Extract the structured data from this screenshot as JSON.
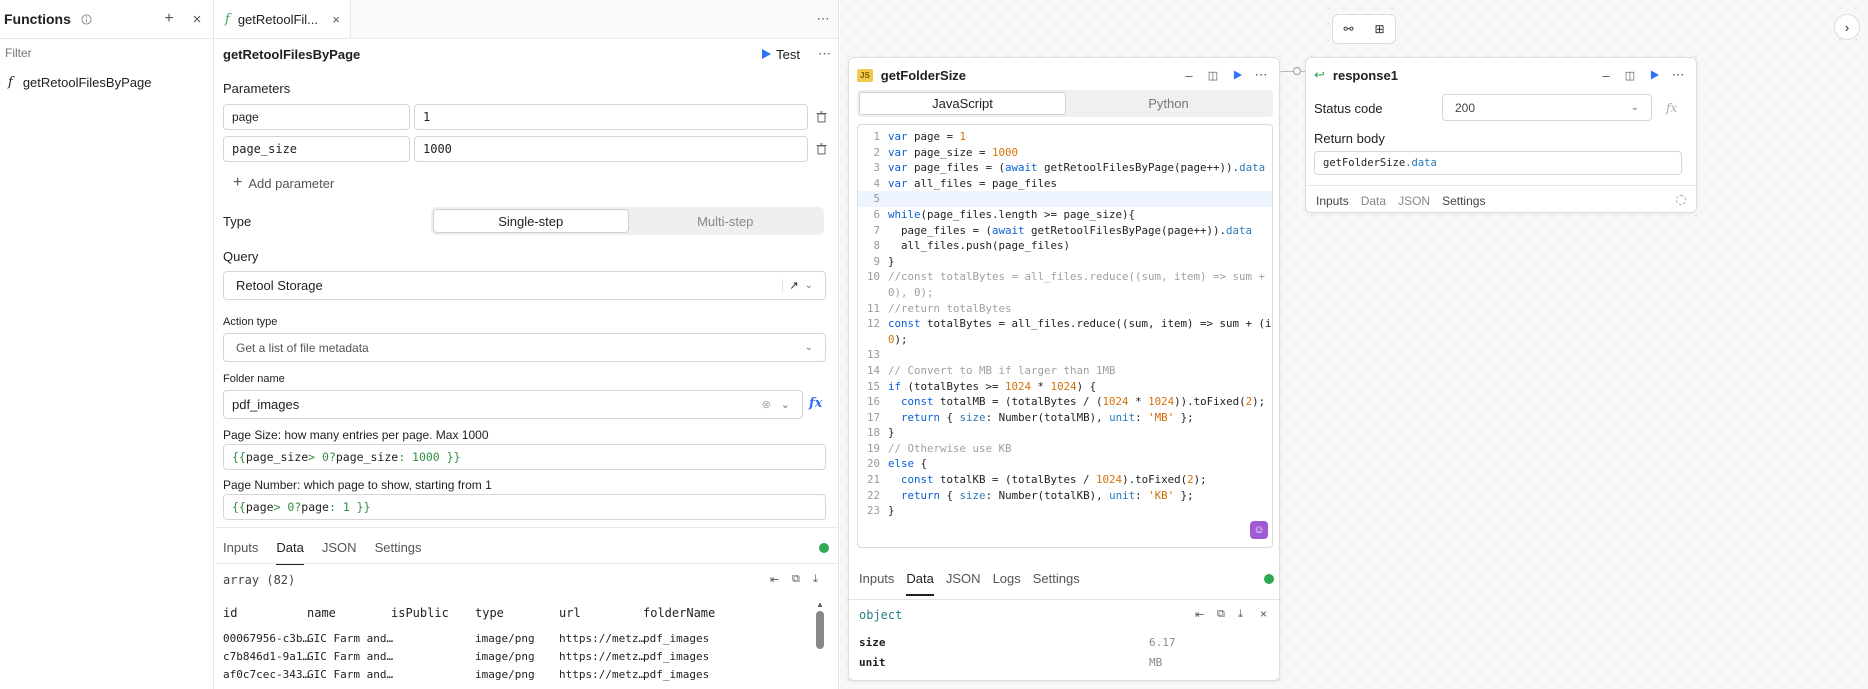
{
  "functions_panel": {
    "title": "Functions",
    "filter_placeholder": "Filter",
    "items": [
      {
        "label": "getRetoolFilesByPage"
      }
    ]
  },
  "editor": {
    "tab_label": "getRetoolFil...",
    "title": "getRetoolFilesByPage",
    "test_label": "Test",
    "parameters_label": "Parameters",
    "params": [
      {
        "name": "page",
        "value": "1"
      },
      {
        "name": "page_size",
        "value": "1000"
      }
    ],
    "add_parameter_label": "Add parameter",
    "type_label": "Type",
    "type_options": [
      "Single-step",
      "Multi-step"
    ],
    "query_label": "Query",
    "query_value": "Retool Storage",
    "action_type_label": "Action type",
    "action_type_value": "Get a list of file metadata",
    "folder_name_label": "Folder name",
    "folder_name_value": "pdf_images",
    "page_size_label": "Page Size: how many entries per page. Max 1000",
    "page_size_expr": [
      "{{ ",
      "page_size",
      " > 0? ",
      "page_size",
      " : 1000 }}"
    ],
    "page_number_label": "Page Number: which page to show, starting from 1",
    "page_number_expr": [
      "{{ ",
      "page",
      " > 0? ",
      "page",
      " : 1 }}"
    ],
    "result_tabs": [
      "Inputs",
      "Data",
      "JSON",
      "Settings"
    ],
    "array_label": "array (82)",
    "table_columns": [
      "id",
      "name",
      "isPublic",
      "type",
      "url",
      "folderName"
    ],
    "table_rows": [
      [
        "00067956-c3b…",
        "GIC Farm and…",
        "",
        "image/png",
        "https://metz…",
        "pdf_images"
      ],
      [
        "c7b846d1-9a1…",
        "GIC Farm and…",
        "",
        "image/png",
        "https://metz…",
        "pdf_images"
      ],
      [
        "af0c7cec-343…",
        "GIC Farm and…",
        "",
        "image/png",
        "https://metz…",
        "pdf_images"
      ]
    ]
  },
  "folder_size_card": {
    "title": "getFolderSize",
    "badge": "JS",
    "lang_tabs": [
      "JavaScript",
      "Python"
    ],
    "bottom_tabs": [
      "Inputs",
      "Data",
      "JSON",
      "Logs",
      "Settings"
    ],
    "result_type": "object",
    "result_rows": [
      {
        "key": "size",
        "value": "6.17"
      },
      {
        "key": "unit",
        "value": "MB"
      }
    ]
  },
  "response_card": {
    "title": "response1",
    "status_code_label": "Status code",
    "status_code_value": "200",
    "return_body_label": "Return body",
    "return_body_value": [
      "getFolderSize",
      ".data"
    ],
    "bottom_tabs": [
      "Inputs",
      "Data",
      "JSON",
      "Settings"
    ]
  },
  "colors": {
    "accent": "#3170f9",
    "success": "#2fa84f",
    "ai_button": "#a05ad6"
  }
}
